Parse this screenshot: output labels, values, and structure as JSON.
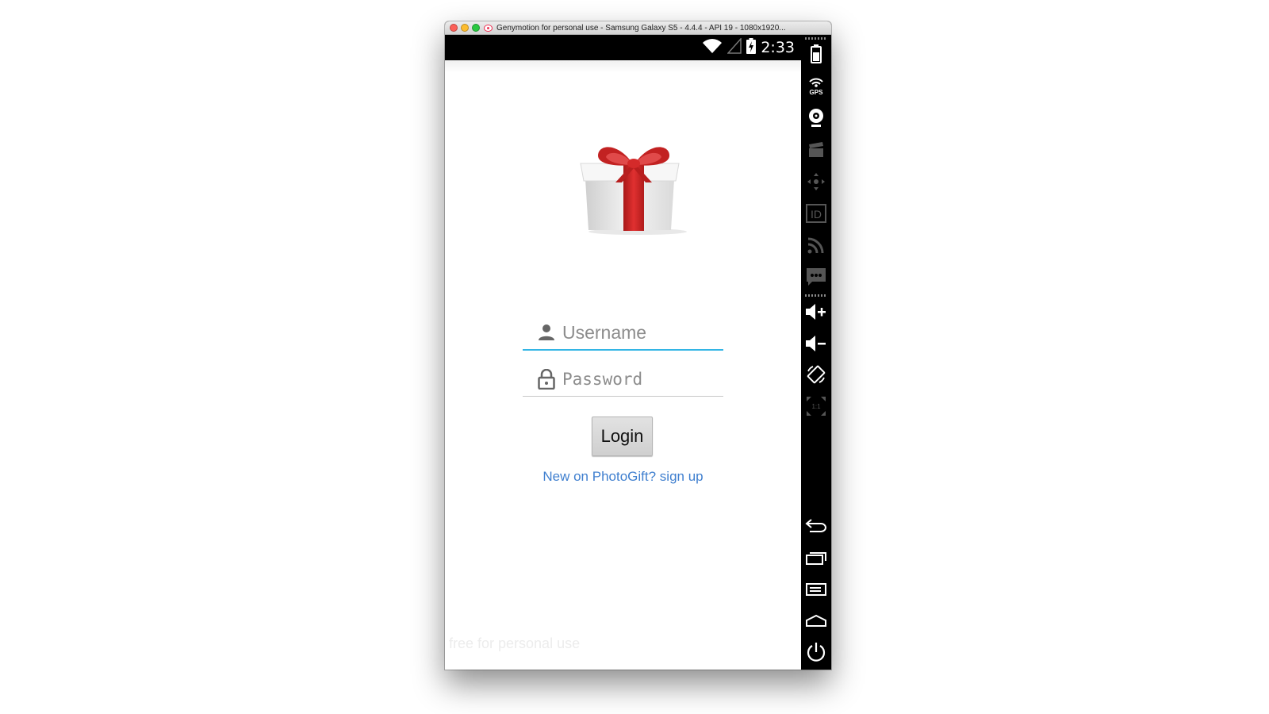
{
  "window": {
    "title": "Genymotion for personal use - Samsung Galaxy S5 - 4.4.4 - API 19 - 1080x1920..."
  },
  "status_bar": {
    "time": "2:33",
    "icons": [
      "wifi-icon",
      "signal-icon",
      "battery-charging-icon"
    ]
  },
  "login": {
    "logo": "gift-box-logo",
    "username_placeholder": "Username",
    "password_placeholder": "Password",
    "login_label": "Login",
    "signup_link": "New on PhotoGift? sign up",
    "watermark": "free for personal use"
  },
  "sidebar": {
    "tools": [
      "battery-icon",
      "gps-icon",
      "webcam-icon",
      "screencast-icon",
      "dpad-icon",
      "id-icon",
      "rss-icon",
      "sms-icon"
    ],
    "gps_label": "GPS",
    "id_label": "ID",
    "hardware": [
      "volume-up-icon",
      "volume-down-icon",
      "rotate-icon",
      "pixel-perfect-icon",
      "back-icon",
      "recent-apps-icon",
      "menu-icon",
      "home-icon",
      "power-icon"
    ],
    "pixel_perfect_label": "1:1"
  },
  "colors": {
    "accent": "#33b5e5",
    "link": "#3f7fcf",
    "gift_ribbon": "#d42a2a"
  }
}
